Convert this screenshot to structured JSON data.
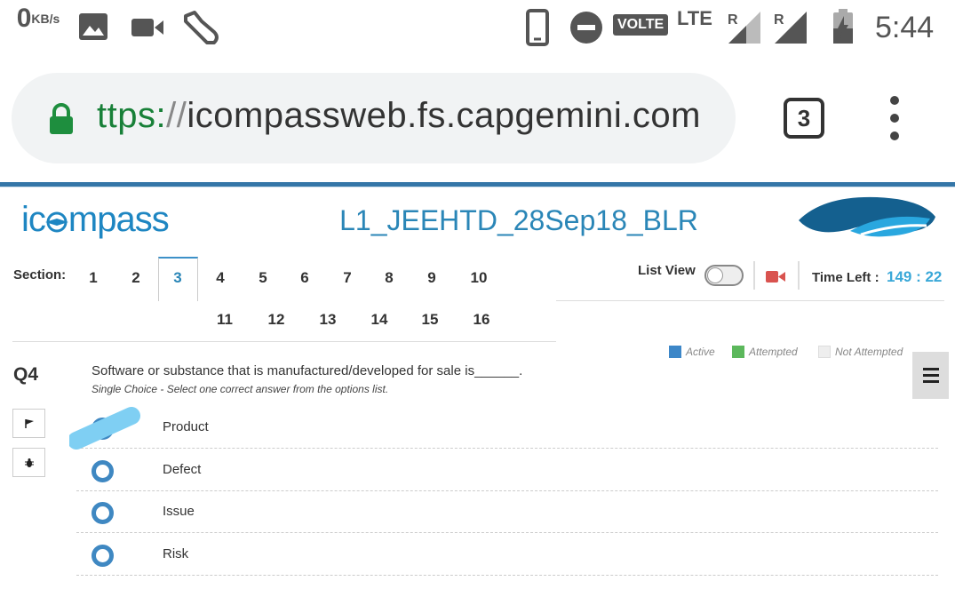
{
  "status_bar": {
    "speed_value": "0",
    "speed_unit": "KB/s",
    "volte": "VOLTE",
    "lte": "LTE",
    "roaming_1": "R",
    "roaming_2": "R",
    "clock": "5:44",
    "icons": [
      "image-icon",
      "video-camera-icon",
      "shoe-icon",
      "phone-icon",
      "do-not-disturb-icon",
      "signal-icon",
      "signal-icon",
      "battery-charging-icon"
    ]
  },
  "browser": {
    "url_scheme": "ttps:",
    "url_sep": "//",
    "url_host": "icompassweb.fs.capgemini.com",
    "tab_count": "3",
    "lock_color": "#1e8e3e"
  },
  "header": {
    "logo_text_1": "ic",
    "logo_text_2": "mpass",
    "exam_title": "L1_JEEHTD_28Sep18_BLR"
  },
  "sections": {
    "label": "Section:",
    "row1": [
      "1",
      "2",
      "3",
      "4",
      "5",
      "6",
      "7",
      "8",
      "9",
      "10"
    ],
    "row2": [
      "11",
      "12",
      "13",
      "14",
      "15",
      "16"
    ],
    "active": "3"
  },
  "controls": {
    "list_view_label": "List View",
    "time_left_label": "Time Left :",
    "time_left_value": "149 : 22"
  },
  "legend": {
    "active": "Active",
    "attempted": "Attempted",
    "not_attempted": "Not Attempted",
    "colors": {
      "active": "#3d87c8",
      "attempted": "#5cb85c",
      "not_attempted": "#eeeeee"
    }
  },
  "question": {
    "number": "Q4",
    "text": "Software or substance that is manufactured/developed for sale is______.",
    "hint": "Single Choice - Select one correct answer from the options list.",
    "options": [
      "Product",
      "Defect",
      "Issue",
      "Risk"
    ]
  }
}
